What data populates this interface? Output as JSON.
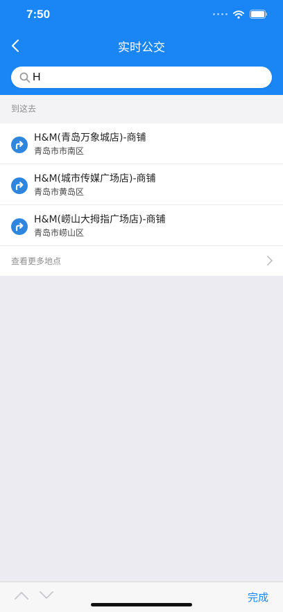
{
  "status_bar": {
    "time": "7:50"
  },
  "header": {
    "title": "实时公交"
  },
  "search": {
    "value": "H",
    "placeholder": ""
  },
  "section": {
    "label": "到这去"
  },
  "results": [
    {
      "title": "H&M(青岛万象城店)-商铺",
      "subtitle": "青岛市市南区",
      "icon": "directions-icon"
    },
    {
      "title": "H&M(城市传媒广场店)-商铺",
      "subtitle": "青岛市黄岛区",
      "icon": "directions-icon"
    },
    {
      "title": "H&M(崂山大拇指广场店)-商铺",
      "subtitle": "青岛市崂山区",
      "icon": "directions-icon"
    }
  ],
  "more": {
    "label": "查看更多地点"
  },
  "toolbar": {
    "done_label": "完成"
  },
  "colors": {
    "brand_blue": "#1a86f5",
    "background": "#ecebf1",
    "directions_icon": "#2e86de"
  }
}
